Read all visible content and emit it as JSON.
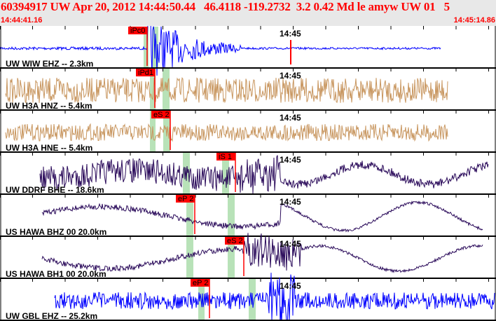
{
  "header": {
    "title": "60394917 UW Apr 20, 2012 14:44:50.44   46.4118 -119.2732  3.2 0.42 Md le amyw UW 01   5",
    "start_time": "14:44:41.16",
    "end_time": "14:45:14.86"
  },
  "minute_mark": "14:45",
  "colors": {
    "accent": "#ff0000",
    "blue": "#0000ff",
    "tan": "#c8965f",
    "purple": "#2a0a5a",
    "green_band": "#b8e2b8"
  },
  "traces": [
    {
      "label": "UW WIW EHZ -- 2.3km",
      "pick": "iPc0",
      "color": "#0000ff"
    },
    {
      "label": "UW H3A HNZ -- 5.4km",
      "pick": "iPd1",
      "color": "#c8965f"
    },
    {
      "label": "UW H3A HNE -- 5.4km",
      "pick": "eS 2",
      "color": "#c8965f"
    },
    {
      "label": "UW DDRF BHE -- 18.6km",
      "pick": "iS 1",
      "color": "#2a0a5a"
    },
    {
      "label": "US HAWA BHZ 00 20.0km",
      "pick": "eP 2",
      "color": "#2a0a5a"
    },
    {
      "label": "US HAWA BH1 00 20.0km",
      "pick": "eS 2",
      "color": "#2a0a5a"
    },
    {
      "label": "UW GBL EHZ -- 25.2km",
      "pick": "eP 2",
      "color": "#0000ff"
    }
  ]
}
